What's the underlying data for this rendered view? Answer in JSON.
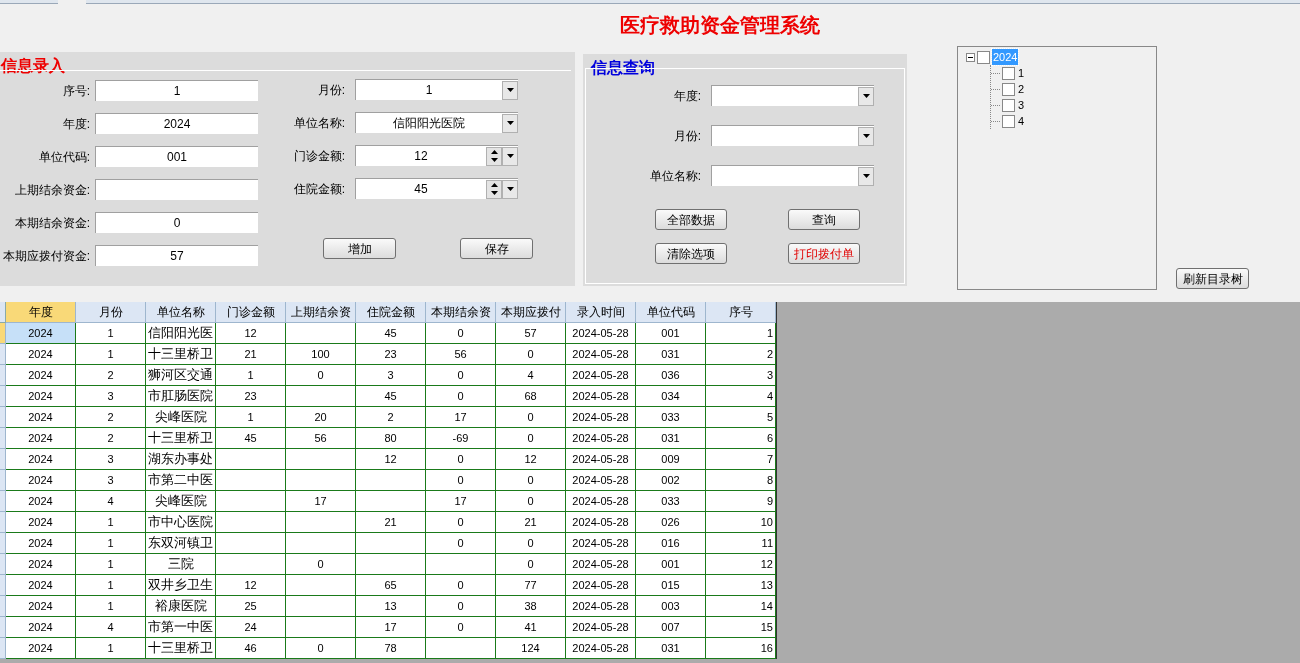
{
  "title": "医疗救助资金管理系统",
  "entry": {
    "legend": "信息录入",
    "left_fields": [
      {
        "label": "序号:",
        "kind": "text",
        "value": "1"
      },
      {
        "label": "年度:",
        "kind": "text",
        "value": "2024"
      },
      {
        "label": "单位代码:",
        "kind": "text",
        "value": "001"
      },
      {
        "label": "上期结余资金:",
        "kind": "text"
      },
      {
        "label": "本期结余资金:",
        "kind": "text",
        "value": "0"
      },
      {
        "label": "本期应拨付资金:",
        "kind": "text",
        "value": "57"
      }
    ],
    "right_fields": [
      {
        "label": "月份:",
        "kind": "combo",
        "value": "1"
      },
      {
        "label": "单位名称:",
        "kind": "combo",
        "value": "信阳阳光医院"
      },
      {
        "label": "门诊金额:",
        "kind": "spin",
        "value": "12"
      },
      {
        "label": "住院金额:",
        "kind": "spin",
        "value": "45"
      }
    ],
    "buttons": [
      {
        "label": "增加",
        "kind": "normal"
      },
      {
        "label": "保存",
        "kind": "normal"
      }
    ]
  },
  "query": {
    "legend": "信息查询",
    "fields": [
      {
        "label": "年度:",
        "kind": "combo"
      },
      {
        "label": "月份:",
        "kind": "combo"
      },
      {
        "label": "单位名称:",
        "kind": "combo"
      }
    ],
    "buttons": [
      {
        "label": "全部数据",
        "kind": "normal"
      },
      {
        "label": "查询",
        "kind": "normal"
      },
      {
        "label": "清除选项",
        "kind": "normal"
      },
      {
        "label": "打印拨付单",
        "kind": "warning"
      }
    ]
  },
  "tree": [
    {
      "label": "2024",
      "checked": false,
      "expanded": true,
      "selected": true,
      "children": [
        {
          "label": "1",
          "checked": false,
          "selected": false
        },
        {
          "label": "2",
          "checked": false,
          "selected": false
        },
        {
          "label": "3",
          "checked": false,
          "selected": false
        },
        {
          "label": "4",
          "checked": false,
          "selected": false
        }
      ]
    }
  ],
  "refresh_button": "刷新目录树",
  "table": {
    "columns": [
      {
        "label": "年度",
        "selected": true
      },
      {
        "label": "月份",
        "selected": false
      },
      {
        "label": "单位名称",
        "selected": false
      },
      {
        "label": "门诊金额",
        "selected": false
      },
      {
        "label": "上期结余资",
        "selected": false
      },
      {
        "label": "住院金额",
        "selected": false
      },
      {
        "label": "本期结余资",
        "selected": false
      },
      {
        "label": "本期应拨付",
        "selected": false
      },
      {
        "label": "录入时间",
        "selected": false
      },
      {
        "label": "单位代码",
        "selected": false
      },
      {
        "label": "序号",
        "selected": false
      }
    ],
    "rows": [
      {
        "selected": true,
        "cells": [
          "2024",
          "1",
          "信阳阳光医",
          "12",
          "",
          "45",
          "0",
          "57",
          "2024-05-28",
          "001",
          "1"
        ]
      },
      {
        "selected": false,
        "cells": [
          "2024",
          "1",
          "十三里桥卫",
          "21",
          "100",
          "23",
          "56",
          "0",
          "2024-05-28",
          "031",
          "2"
        ]
      },
      {
        "selected": false,
        "cells": [
          "2024",
          "2",
          "狮河区交通",
          "1",
          "0",
          "3",
          "0",
          "4",
          "2024-05-28",
          "036",
          "3"
        ]
      },
      {
        "selected": false,
        "cells": [
          "2024",
          "3",
          "市肛肠医院",
          "23",
          "",
          "45",
          "0",
          "68",
          "2024-05-28",
          "034",
          "4"
        ]
      },
      {
        "selected": false,
        "cells": [
          "2024",
          "2",
          "尖峰医院",
          "1",
          "20",
          "2",
          "17",
          "0",
          "2024-05-28",
          "033",
          "5"
        ]
      },
      {
        "selected": false,
        "cells": [
          "2024",
          "2",
          "十三里桥卫",
          "45",
          "56",
          "80",
          "-69",
          "0",
          "2024-05-28",
          "031",
          "6"
        ]
      },
      {
        "selected": false,
        "cells": [
          "2024",
          "3",
          "湖东办事处",
          "",
          "",
          "12",
          "0",
          "12",
          "2024-05-28",
          "009",
          "7"
        ]
      },
      {
        "selected": false,
        "cells": [
          "2024",
          "3",
          "市第二中医",
          "",
          "",
          "",
          "0",
          "0",
          "2024-05-28",
          "002",
          "8"
        ]
      },
      {
        "selected": false,
        "cells": [
          "2024",
          "4",
          "尖峰医院",
          "",
          "17",
          "",
          "17",
          "0",
          "2024-05-28",
          "033",
          "9"
        ]
      },
      {
        "selected": false,
        "cells": [
          "2024",
          "1",
          "市中心医院",
          "",
          "",
          "21",
          "0",
          "21",
          "2024-05-28",
          "026",
          "10"
        ]
      },
      {
        "selected": false,
        "cells": [
          "2024",
          "1",
          "东双河镇卫",
          "",
          "",
          "",
          "0",
          "0",
          "2024-05-28",
          "016",
          "11"
        ]
      },
      {
        "selected": false,
        "cells": [
          "2024",
          "1",
          "三院",
          "",
          "0",
          "",
          "",
          "0",
          "2024-05-28",
          "001",
          "12"
        ]
      },
      {
        "selected": false,
        "cells": [
          "2024",
          "1",
          "双井乡卫生",
          "12",
          "",
          "65",
          "0",
          "77",
          "2024-05-28",
          "015",
          "13"
        ]
      },
      {
        "selected": false,
        "cells": [
          "2024",
          "1",
          "裕康医院",
          "25",
          "",
          "13",
          "0",
          "38",
          "2024-05-28",
          "003",
          "14"
        ]
      },
      {
        "selected": false,
        "cells": [
          "2024",
          "4",
          "市第一中医",
          "24",
          "",
          "17",
          "0",
          "41",
          "2024-05-28",
          "007",
          "15"
        ]
      },
      {
        "selected": false,
        "cells": [
          "2024",
          "1",
          "十三里桥卫",
          "46",
          "0",
          "78",
          "",
          "124",
          "2024-05-28",
          "031",
          "16"
        ]
      }
    ]
  }
}
